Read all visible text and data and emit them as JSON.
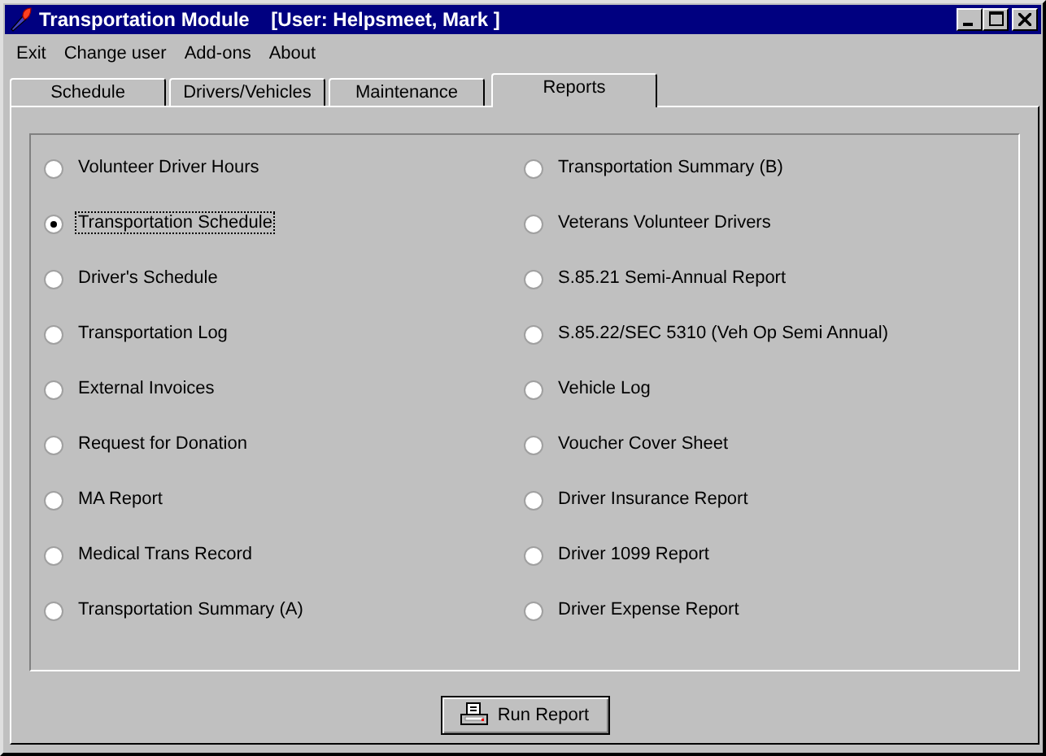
{
  "window": {
    "title": "Transportation Module    [User: Helpsmeet, Mark ]"
  },
  "menu": [
    "Exit",
    "Change user",
    "Add-ons",
    "About"
  ],
  "tabs": [
    {
      "label": "Schedule",
      "selected": false
    },
    {
      "label": "Drivers/Vehicles",
      "selected": false
    },
    {
      "label": "Maintenance",
      "selected": false
    },
    {
      "label": "Reports",
      "selected": true
    }
  ],
  "report_columns": [
    {
      "items": [
        {
          "label": "Volunteer Driver Hours",
          "selected": false
        },
        {
          "label": "Transportation Schedule",
          "selected": true
        },
        {
          "label": "Driver's Schedule",
          "selected": false
        },
        {
          "label": "Transportation Log",
          "selected": false
        },
        {
          "label": "External Invoices",
          "selected": false
        },
        {
          "label": "Request for Donation",
          "selected": false
        },
        {
          "label": "MA Report",
          "selected": false
        },
        {
          "label": "Medical Trans Record",
          "selected": false
        },
        {
          "label": "Transportation Summary (A)",
          "selected": false
        }
      ]
    },
    {
      "items": [
        {
          "label": "Transportation Summary (B)",
          "selected": false
        },
        {
          "label": "Veterans Volunteer Drivers",
          "selected": false
        },
        {
          "label": "S.85.21 Semi-Annual Report",
          "selected": false
        },
        {
          "label": "S.85.22/SEC 5310 (Veh Op Semi Annual)",
          "selected": false
        },
        {
          "label": "Vehicle Log",
          "selected": false
        },
        {
          "label": "Voucher Cover Sheet",
          "selected": false
        },
        {
          "label": "Driver Insurance Report",
          "selected": false
        },
        {
          "label": "Driver 1099 Report",
          "selected": false
        },
        {
          "label": "Driver Expense Report",
          "selected": false
        }
      ]
    }
  ],
  "run_button": {
    "label": "Run Report"
  }
}
